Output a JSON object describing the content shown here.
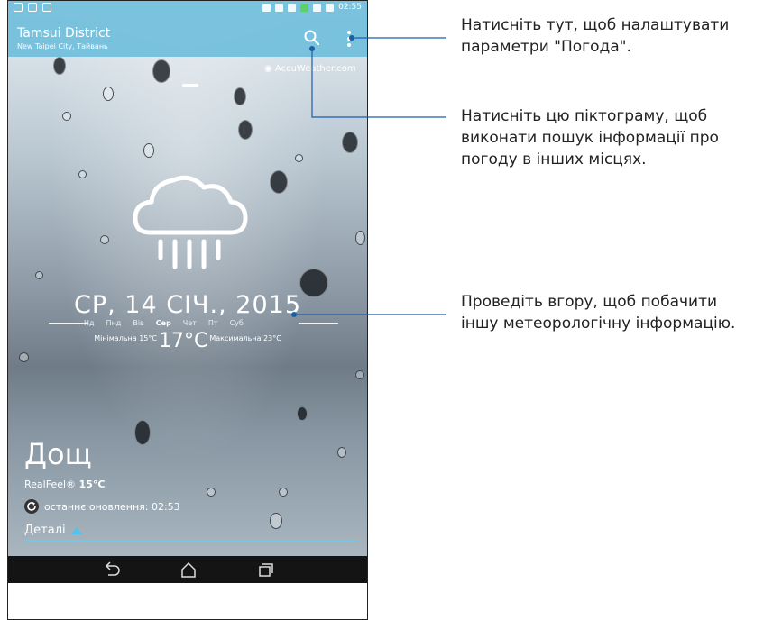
{
  "status_bar": {
    "time": "02:55"
  },
  "header": {
    "city": "Tamsui District",
    "region": "New Taipei City, Тайвань"
  },
  "provider": "AccuWeather.com",
  "forecast": {
    "date": "СР, 14 СІЧ., 2015",
    "days": [
      "Нд",
      "Пнд",
      "Вів",
      "Сер",
      "Чет",
      "Пт",
      "Суб"
    ],
    "active_day": "Сер",
    "min_label": "Мінімальна 15°C",
    "current_temp": "17°C",
    "max_label": "Максимальна 23°C"
  },
  "condition": {
    "text": "Дощ",
    "realfeel_label": "RealFeel®",
    "realfeel_value": "15°C",
    "last_update": "останнє оновлення: 02:53",
    "details_label": "Деталі"
  },
  "icons": {
    "weather": "rain-cloud-icon",
    "search": "search-icon",
    "menu": "more-vert-icon",
    "refresh": "refresh-icon",
    "back": "back-icon",
    "home": "home-icon",
    "recent": "recent-apps-icon"
  },
  "callouts": [
    {
      "line1": "Натисніть тут, щоб налаштувати",
      "line2": "параметри \"Погода\".",
      "line3": ""
    },
    {
      "line1": "Натисніть цю піктограму, щоб",
      "line2": "виконати пошук інформації про",
      "line3": "погоду в інших місцях."
    },
    {
      "line1": "Проведіть вгору, щоб побачити",
      "line2": "іншу метеорологічну інформацію.",
      "line3": ""
    }
  ],
  "colors": {
    "accent": "#4ec3ee",
    "header": "#6ebedc"
  }
}
